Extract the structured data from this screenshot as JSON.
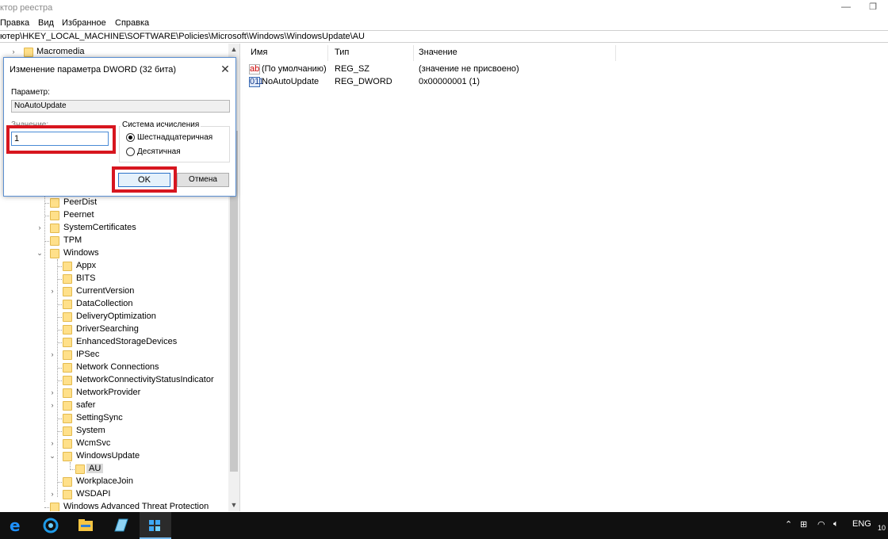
{
  "window": {
    "title": "ктор реестра",
    "minimize_icon": "minimize-icon",
    "maximize_icon": "restore-icon"
  },
  "menu": [
    "Правка",
    "Вид",
    "Избранное",
    "Справка"
  ],
  "address": "ютер\\HKEY_LOCAL_MACHINE\\SOFTWARE\\Policies\\Microsoft\\Windows\\WindowsUpdate\\AU",
  "tree": {
    "top_item": "Macromedia",
    "items": [
      {
        "label": "PeerDist"
      },
      {
        "label": "Peernet"
      },
      {
        "label": "SystemCertificates"
      },
      {
        "label": "TPM"
      },
      {
        "label": "Windows"
      },
      {
        "label": "Appx"
      },
      {
        "label": "BITS"
      },
      {
        "label": "CurrentVersion"
      },
      {
        "label": "DataCollection"
      },
      {
        "label": "DeliveryOptimization"
      },
      {
        "label": "DriverSearching"
      },
      {
        "label": "EnhancedStorageDevices"
      },
      {
        "label": "IPSec"
      },
      {
        "label": "Network Connections"
      },
      {
        "label": "NetworkConnectivityStatusIndicator"
      },
      {
        "label": "NetworkProvider"
      },
      {
        "label": "safer"
      },
      {
        "label": "SettingSync"
      },
      {
        "label": "System"
      },
      {
        "label": "WcmSvc"
      },
      {
        "label": "WindowsUpdate"
      },
      {
        "label": "AU"
      },
      {
        "label": "WorkplaceJoin"
      },
      {
        "label": "WSDAPI"
      },
      {
        "label": "Windows Advanced Threat Protection"
      }
    ],
    "selected": "AU"
  },
  "values_pane": {
    "columns": [
      "Имя",
      "Тип",
      "Значение"
    ],
    "rows": [
      {
        "name": "(По умолчанию)",
        "type": "REG_SZ",
        "value": "(значение не присвоено)",
        "icon": "string-value-icon"
      },
      {
        "name": "NoAutoUpdate",
        "type": "REG_DWORD",
        "value": "0x00000001 (1)",
        "icon": "dword-value-icon"
      }
    ]
  },
  "dialog": {
    "title": "Изменение параметра DWORD (32 бита)",
    "param_label": "Параметр:",
    "param_value": "NoAutoUpdate",
    "value_label": "Значение:",
    "value": "1",
    "base_label": "Система исчисления",
    "base_options": [
      "Шестнадцатеричная",
      "Десятичная"
    ],
    "base_selected": "Шестнадцатеричная",
    "ok_label": "OK",
    "cancel_label": "Отмена",
    "highlight_color": "#d7161f"
  },
  "taskbar": {
    "apps": [
      "edge-icon",
      "browser-icon",
      "file-explorer-icon",
      "notepad-icon",
      "registry-editor-icon"
    ],
    "active_app": "registry-editor-icon",
    "language": "ENG",
    "clock": "10"
  }
}
